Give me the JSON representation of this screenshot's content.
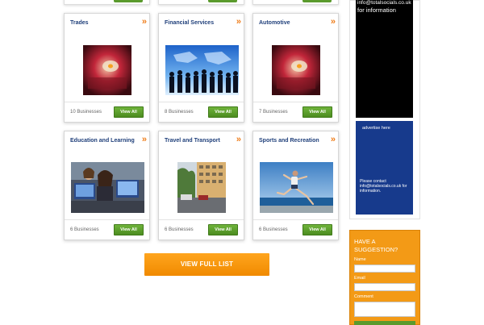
{
  "categories": [
    {
      "title": "Trades",
      "count": "10 Businesses",
      "button": "View All",
      "image": "candle-closeup"
    },
    {
      "title": "Financial Services",
      "count": "8 Businesses",
      "button": "View All",
      "image": "business-people-world-map"
    },
    {
      "title": "Automotive",
      "count": "7 Businesses",
      "button": "View All",
      "image": "candle-closeup"
    },
    {
      "title": "Education and Learning",
      "count": "6 Businesses",
      "button": "View All",
      "image": "students-at-computers"
    },
    {
      "title": "Travel and Transport",
      "count": "6 Businesses",
      "button": "View All",
      "image": "city-street"
    },
    {
      "title": "Sports and Recreation",
      "count": "6 Businesses",
      "button": "View All",
      "image": "runner-on-beach"
    }
  ],
  "chevron": "»",
  "view_full_list": "VIEW FULL LIST",
  "sidebar": {
    "ad_top_line1": "info@totalsocials.co.uk",
    "ad_top_line2": "for information",
    "ad_blue_heading": "advertise here",
    "ad_blue_contact": "Please contact info@totalsocials.co.uk for information.",
    "suggestion": {
      "title": "HAVE A SUGGESTION?",
      "name_label": "Name",
      "email_label": "Email",
      "comment_label": "Comment"
    }
  },
  "colors": {
    "title_blue": "#1f3f7a",
    "button_green": "#5a9a2c",
    "accent_orange": "#f39a16",
    "ad_blue": "#173a8c"
  }
}
